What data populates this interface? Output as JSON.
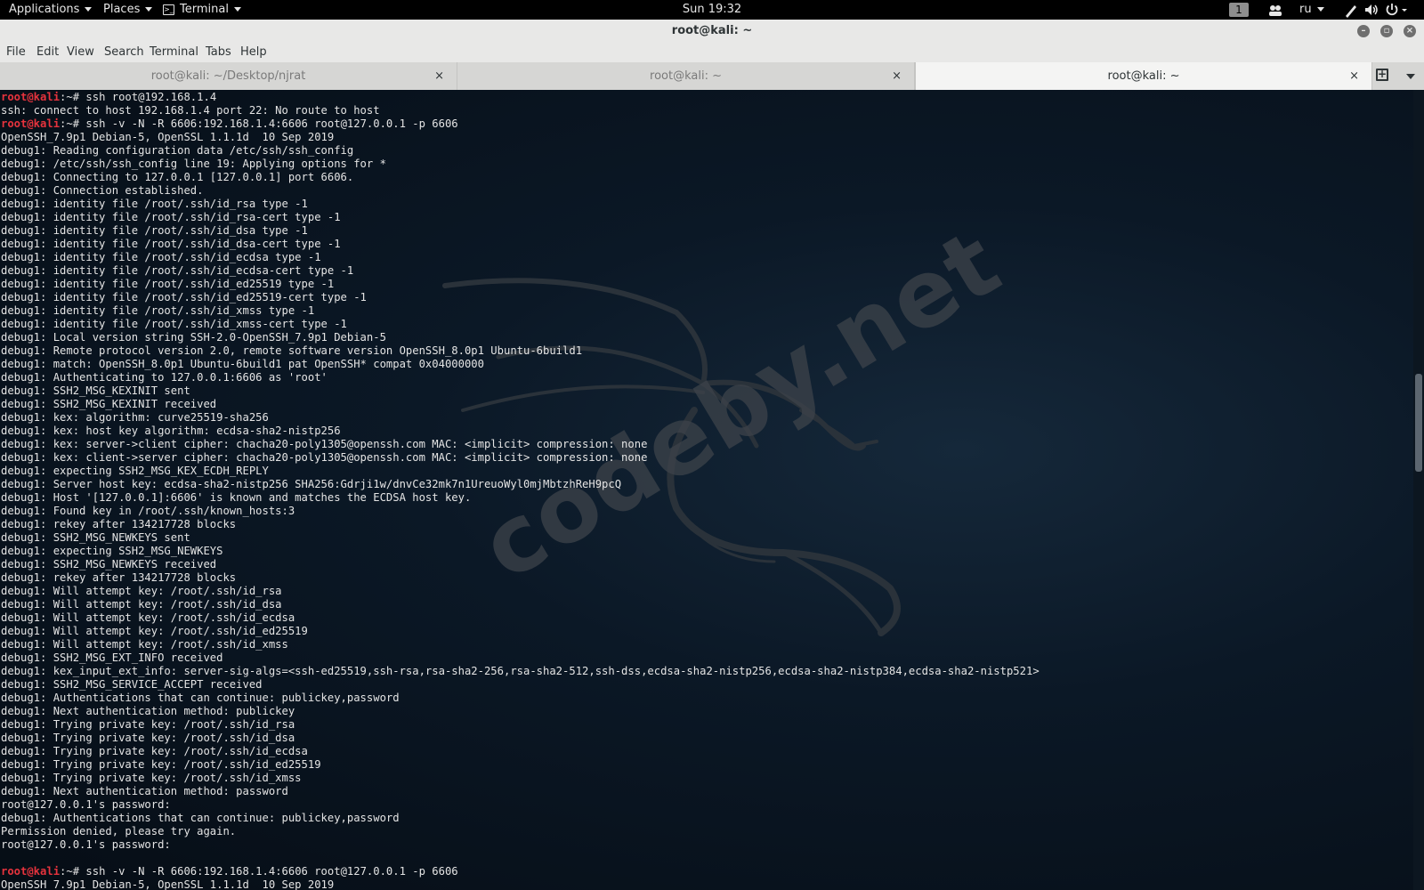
{
  "topbar": {
    "applications": "Applications",
    "places": "Places",
    "terminal": "Terminal",
    "clock": "Sun 19:32",
    "workspace": "1",
    "language": "ru",
    "icons": [
      "users-icon",
      "pen-icon",
      "volume-icon",
      "power-icon"
    ]
  },
  "window": {
    "title": "root@kali: ~"
  },
  "menu": {
    "file": "File",
    "edit": "Edit",
    "view": "View",
    "search": "Search",
    "terminal": "Terminal",
    "tabs": "Tabs",
    "help": "Help"
  },
  "tabs": [
    {
      "label": "root@kali: ~/Desktop/njrat",
      "active": false
    },
    {
      "label": "root@kali: ~",
      "active": false
    },
    {
      "label": "root@kali: ~",
      "active": true
    }
  ],
  "tab_close_glyph": "×",
  "watermark": "codeby.net",
  "prompt": {
    "user": "root@kali",
    "path": ":~# "
  },
  "terminal_lines": [
    {
      "prompt": true,
      "text": "ssh root@192.168.1.4"
    },
    {
      "prompt": false,
      "text": "ssh: connect to host 192.168.1.4 port 22: No route to host"
    },
    {
      "prompt": true,
      "text": "ssh -v -N -R 6606:192.168.1.4:6606 root@127.0.0.1 -p 6606"
    },
    {
      "prompt": false,
      "text": "OpenSSH_7.9p1 Debian-5, OpenSSL 1.1.1d  10 Sep 2019"
    },
    {
      "prompt": false,
      "text": "debug1: Reading configuration data /etc/ssh/ssh_config"
    },
    {
      "prompt": false,
      "text": "debug1: /etc/ssh/ssh_config line 19: Applying options for *"
    },
    {
      "prompt": false,
      "text": "debug1: Connecting to 127.0.0.1 [127.0.0.1] port 6606."
    },
    {
      "prompt": false,
      "text": "debug1: Connection established."
    },
    {
      "prompt": false,
      "text": "debug1: identity file /root/.ssh/id_rsa type -1"
    },
    {
      "prompt": false,
      "text": "debug1: identity file /root/.ssh/id_rsa-cert type -1"
    },
    {
      "prompt": false,
      "text": "debug1: identity file /root/.ssh/id_dsa type -1"
    },
    {
      "prompt": false,
      "text": "debug1: identity file /root/.ssh/id_dsa-cert type -1"
    },
    {
      "prompt": false,
      "text": "debug1: identity file /root/.ssh/id_ecdsa type -1"
    },
    {
      "prompt": false,
      "text": "debug1: identity file /root/.ssh/id_ecdsa-cert type -1"
    },
    {
      "prompt": false,
      "text": "debug1: identity file /root/.ssh/id_ed25519 type -1"
    },
    {
      "prompt": false,
      "text": "debug1: identity file /root/.ssh/id_ed25519-cert type -1"
    },
    {
      "prompt": false,
      "text": "debug1: identity file /root/.ssh/id_xmss type -1"
    },
    {
      "prompt": false,
      "text": "debug1: identity file /root/.ssh/id_xmss-cert type -1"
    },
    {
      "prompt": false,
      "text": "debug1: Local version string SSH-2.0-OpenSSH_7.9p1 Debian-5"
    },
    {
      "prompt": false,
      "text": "debug1: Remote protocol version 2.0, remote software version OpenSSH_8.0p1 Ubuntu-6build1"
    },
    {
      "prompt": false,
      "text": "debug1: match: OpenSSH_8.0p1 Ubuntu-6build1 pat OpenSSH* compat 0x04000000"
    },
    {
      "prompt": false,
      "text": "debug1: Authenticating to 127.0.0.1:6606 as 'root'"
    },
    {
      "prompt": false,
      "text": "debug1: SSH2_MSG_KEXINIT sent"
    },
    {
      "prompt": false,
      "text": "debug1: SSH2_MSG_KEXINIT received"
    },
    {
      "prompt": false,
      "text": "debug1: kex: algorithm: curve25519-sha256"
    },
    {
      "prompt": false,
      "text": "debug1: kex: host key algorithm: ecdsa-sha2-nistp256"
    },
    {
      "prompt": false,
      "text": "debug1: kex: server->client cipher: chacha20-poly1305@openssh.com MAC: <implicit> compression: none"
    },
    {
      "prompt": false,
      "text": "debug1: kex: client->server cipher: chacha20-poly1305@openssh.com MAC: <implicit> compression: none"
    },
    {
      "prompt": false,
      "text": "debug1: expecting SSH2_MSG_KEX_ECDH_REPLY"
    },
    {
      "prompt": false,
      "text": "debug1: Server host key: ecdsa-sha2-nistp256 SHA256:Gdrji1w/dnvCe32mk7n1UreuoWyl0mjMbtzhReH9pcQ"
    },
    {
      "prompt": false,
      "text": "debug1: Host '[127.0.0.1]:6606' is known and matches the ECDSA host key."
    },
    {
      "prompt": false,
      "text": "debug1: Found key in /root/.ssh/known_hosts:3"
    },
    {
      "prompt": false,
      "text": "debug1: rekey after 134217728 blocks"
    },
    {
      "prompt": false,
      "text": "debug1: SSH2_MSG_NEWKEYS sent"
    },
    {
      "prompt": false,
      "text": "debug1: expecting SSH2_MSG_NEWKEYS"
    },
    {
      "prompt": false,
      "text": "debug1: SSH2_MSG_NEWKEYS received"
    },
    {
      "prompt": false,
      "text": "debug1: rekey after 134217728 blocks"
    },
    {
      "prompt": false,
      "text": "debug1: Will attempt key: /root/.ssh/id_rsa"
    },
    {
      "prompt": false,
      "text": "debug1: Will attempt key: /root/.ssh/id_dsa"
    },
    {
      "prompt": false,
      "text": "debug1: Will attempt key: /root/.ssh/id_ecdsa"
    },
    {
      "prompt": false,
      "text": "debug1: Will attempt key: /root/.ssh/id_ed25519"
    },
    {
      "prompt": false,
      "text": "debug1: Will attempt key: /root/.ssh/id_xmss"
    },
    {
      "prompt": false,
      "text": "debug1: SSH2_MSG_EXT_INFO received"
    },
    {
      "prompt": false,
      "text": "debug1: kex_input_ext_info: server-sig-algs=<ssh-ed25519,ssh-rsa,rsa-sha2-256,rsa-sha2-512,ssh-dss,ecdsa-sha2-nistp256,ecdsa-sha2-nistp384,ecdsa-sha2-nistp521>"
    },
    {
      "prompt": false,
      "text": "debug1: SSH2_MSG_SERVICE_ACCEPT received"
    },
    {
      "prompt": false,
      "text": "debug1: Authentications that can continue: publickey,password"
    },
    {
      "prompt": false,
      "text": "debug1: Next authentication method: publickey"
    },
    {
      "prompt": false,
      "text": "debug1: Trying private key: /root/.ssh/id_rsa"
    },
    {
      "prompt": false,
      "text": "debug1: Trying private key: /root/.ssh/id_dsa"
    },
    {
      "prompt": false,
      "text": "debug1: Trying private key: /root/.ssh/id_ecdsa"
    },
    {
      "prompt": false,
      "text": "debug1: Trying private key: /root/.ssh/id_ed25519"
    },
    {
      "prompt": false,
      "text": "debug1: Trying private key: /root/.ssh/id_xmss"
    },
    {
      "prompt": false,
      "text": "debug1: Next authentication method: password"
    },
    {
      "prompt": false,
      "text": "root@127.0.0.1's password:"
    },
    {
      "prompt": false,
      "text": "debug1: Authentications that can continue: publickey,password"
    },
    {
      "prompt": false,
      "text": "Permission denied, please try again."
    },
    {
      "prompt": false,
      "text": "root@127.0.0.1's password:"
    },
    {
      "prompt": false,
      "text": ""
    },
    {
      "prompt": true,
      "text": "ssh -v -N -R 6606:192.168.1.4:6606 root@127.0.0.1 -p 6606"
    },
    {
      "prompt": false,
      "text": "OpenSSH_7.9p1 Debian-5, OpenSSL 1.1.1d  10 Sep 2019"
    }
  ]
}
